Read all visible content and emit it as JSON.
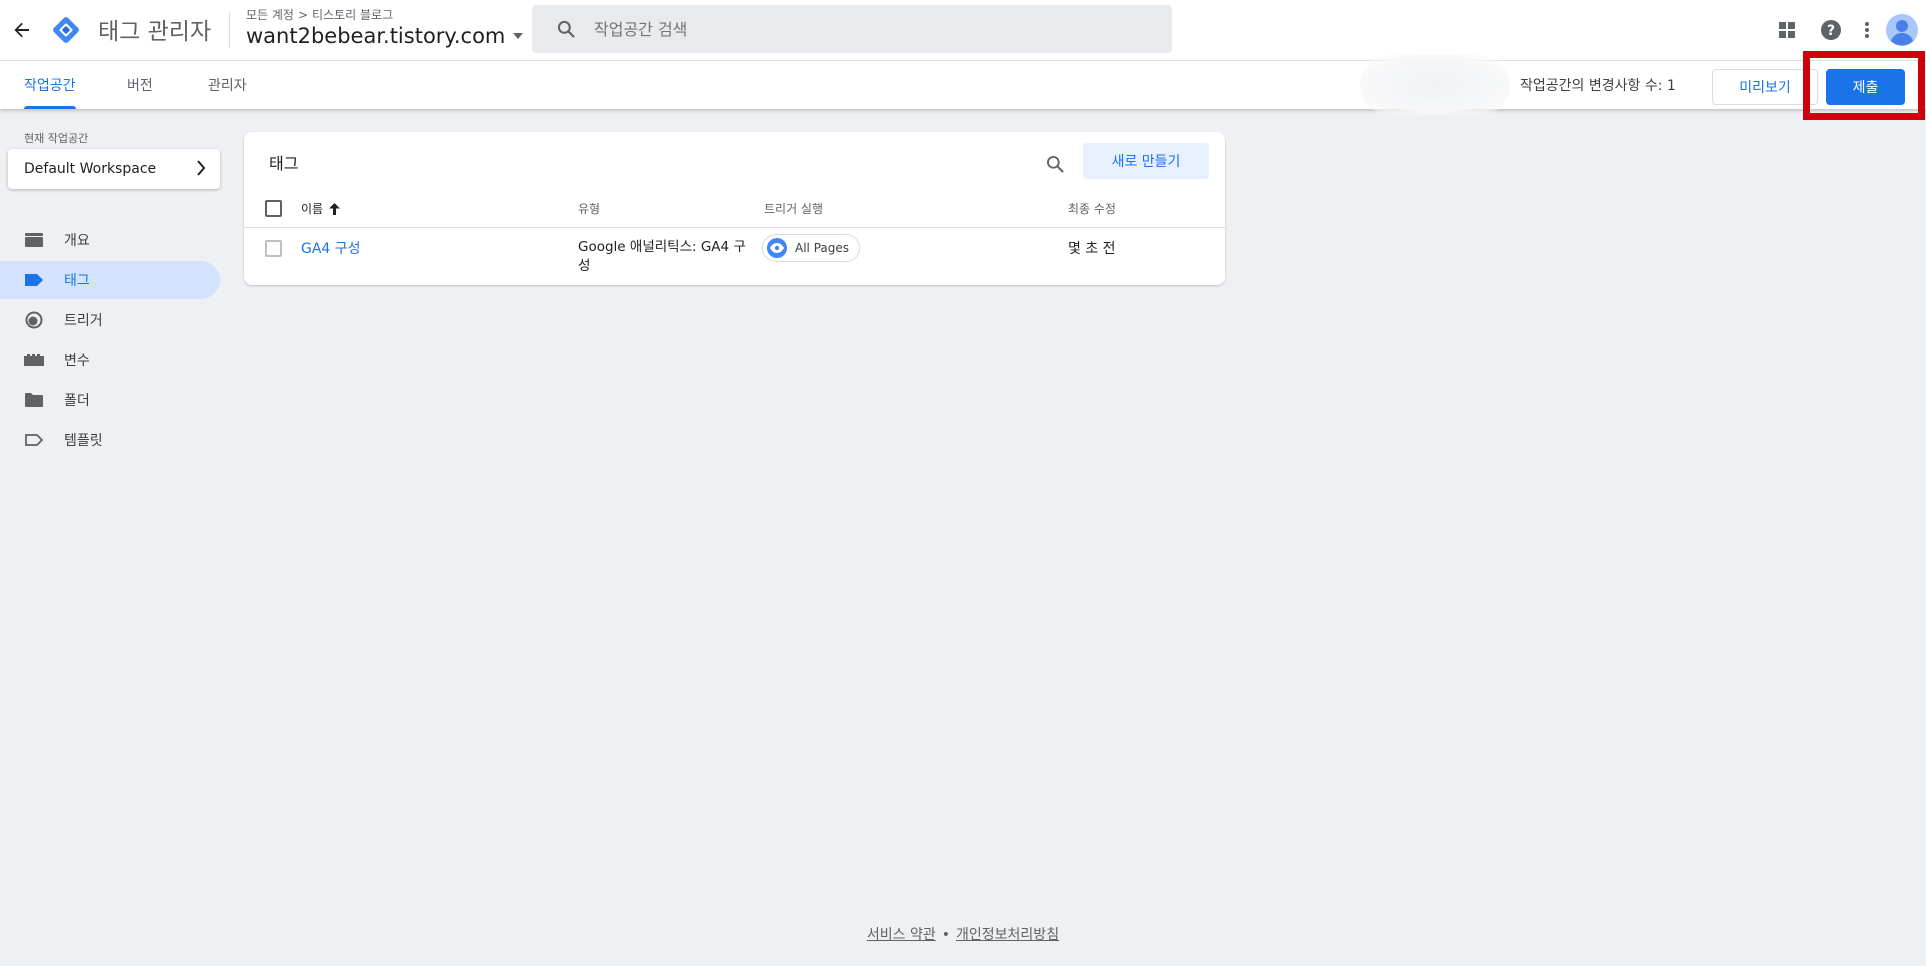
{
  "header": {
    "app_title": "태그 관리자",
    "breadcrumb": [
      "모든 계정",
      "티스토리 블로그"
    ],
    "breadcrumb_separator": ">",
    "container_name": "want2bebear.tistory.com",
    "search_placeholder": "작업공간 검색",
    "icons": [
      "back-arrow-icon",
      "gtm-logo",
      "search-icon",
      "apps-grid-icon",
      "help-icon",
      "more-vert-icon",
      "account-avatar-icon"
    ]
  },
  "subnav": {
    "tabs": [
      {
        "label": "작업공간",
        "active": true
      },
      {
        "label": "버전",
        "active": false
      },
      {
        "label": "관리자",
        "active": false
      }
    ],
    "changes_text": "작업공간의 변경사항 수: 1",
    "preview_label": "미리보기",
    "submit_label": "제출"
  },
  "sidebar": {
    "workspace_label": "현재 작업공간",
    "workspace_name": "Default Workspace",
    "items": [
      {
        "label": "개요",
        "icon": "overview-icon",
        "active": false
      },
      {
        "label": "태그",
        "icon": "tag-icon",
        "active": true
      },
      {
        "label": "트리거",
        "icon": "trigger-icon",
        "active": false
      },
      {
        "label": "변수",
        "icon": "variables-icon",
        "active": false
      },
      {
        "label": "폴더",
        "icon": "folder-icon",
        "active": false
      },
      {
        "label": "템플릿",
        "icon": "template-icon",
        "active": false
      }
    ]
  },
  "tags_card": {
    "title": "태그",
    "new_button": "새로 만들기",
    "columns": {
      "name": "이름",
      "type": "유형",
      "trigger": "트리거 실행",
      "modified": "최종 수정"
    },
    "sort_indicator": "arrow-upward-icon",
    "rows": [
      {
        "name": "GA4 구성",
        "type_line1": "Google 애널리틱스: GA4 구",
        "type_line2": "성",
        "trigger": "All Pages",
        "modified": "몇 초 전"
      }
    ]
  },
  "footer": {
    "terms": "서비스 약관",
    "separator": "•",
    "privacy": "개인정보처리방침"
  },
  "colors": {
    "accent": "#1a73e8",
    "highlight_box": "#d0000a",
    "active_nav_bg": "#d3e3fd",
    "page_bg": "#eef0f3"
  }
}
